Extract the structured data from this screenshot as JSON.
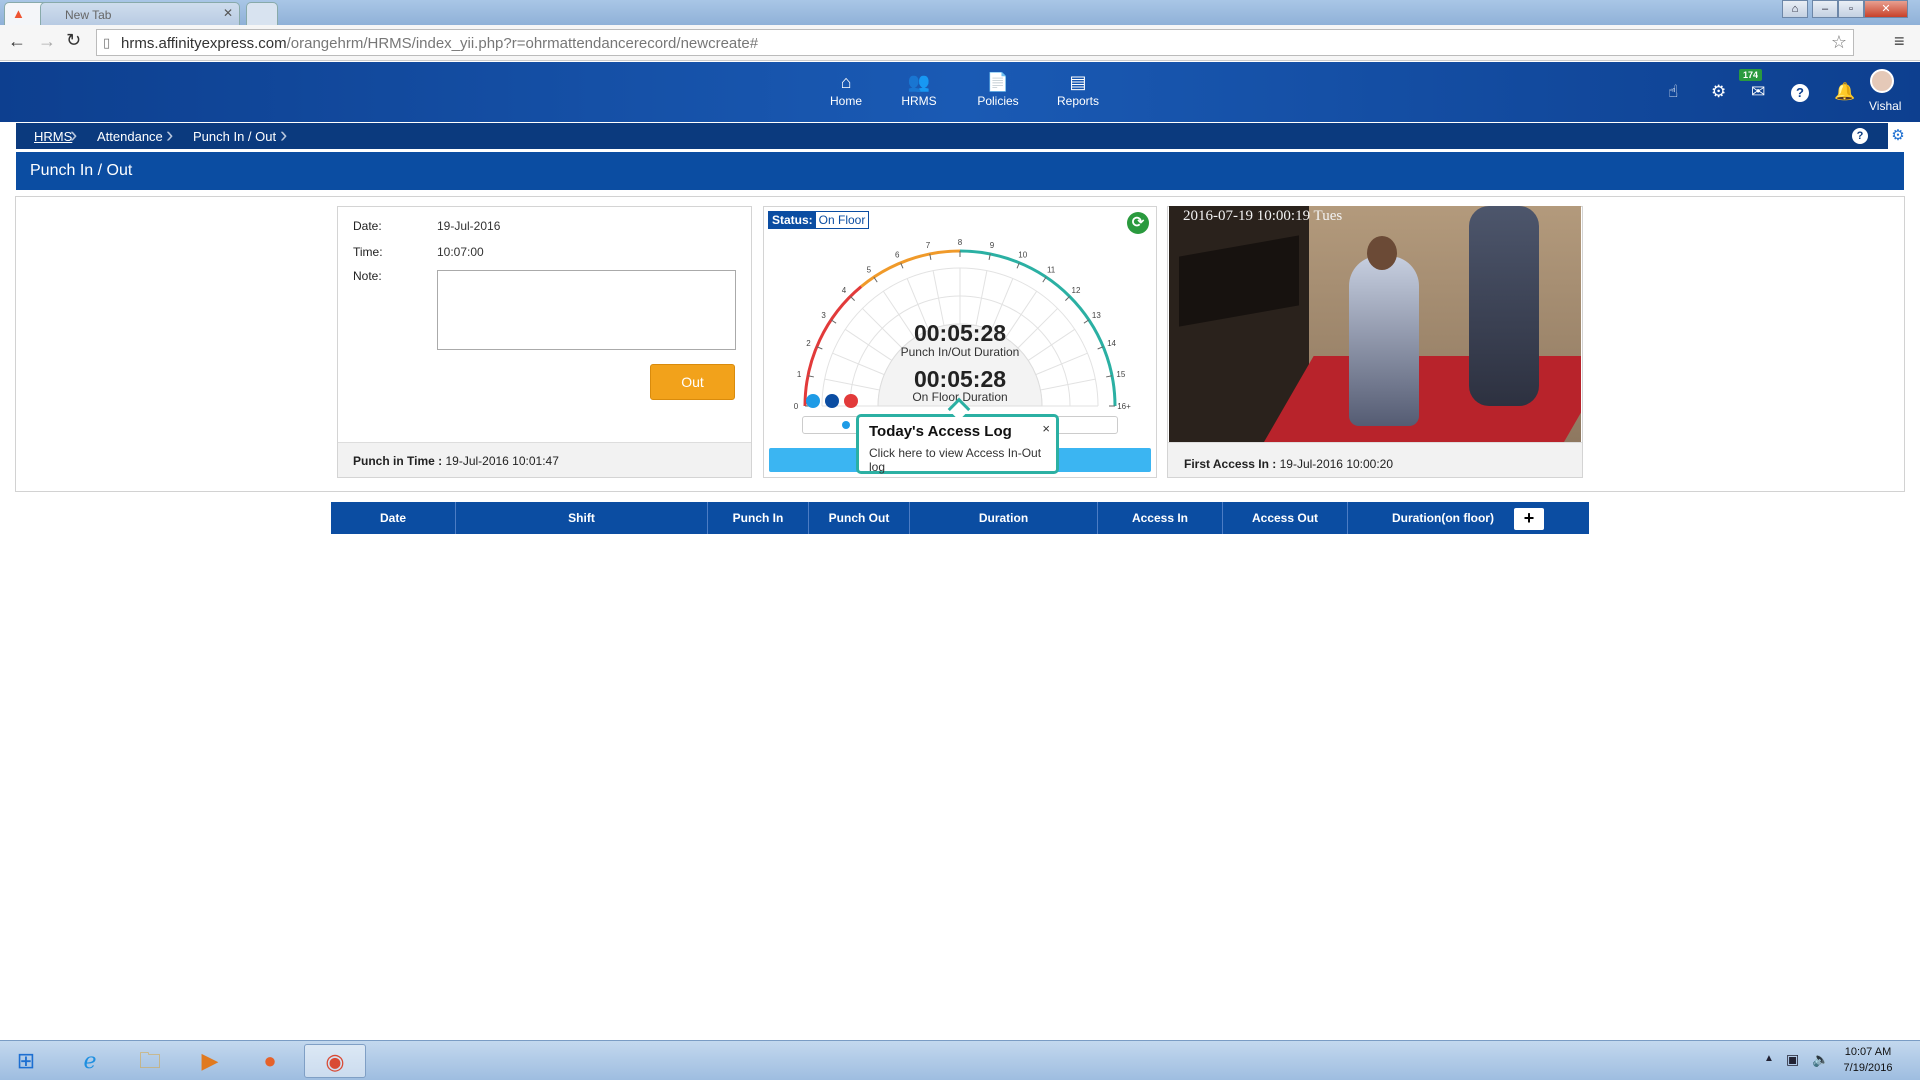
{
  "browser": {
    "tabs": [
      {
        "label": "",
        "active": true
      },
      {
        "label": "New Tab",
        "active": false
      }
    ],
    "url_host": "hrms.affinityexpress.com",
    "url_path": "/orangehrm/HRMS/index_yii.php?r=ohrmattendancerecord/newcreate#"
  },
  "nav": {
    "items": [
      {
        "label": "Home",
        "icon": "home-icon"
      },
      {
        "label": "HRMS",
        "icon": "people-icon"
      },
      {
        "label": "Policies",
        "icon": "policies-icon"
      },
      {
        "label": "Reports",
        "icon": "reports-icon"
      }
    ],
    "mail_badge": "174",
    "user_name": "Vishal"
  },
  "breadcrumb": [
    "HRMS",
    "Attendance",
    "Punch In / Out"
  ],
  "page_title": "Punch In / Out",
  "punch_form": {
    "date_label": "Date:",
    "date_value": "19-Jul-2016",
    "time_label": "Time:",
    "time_value": "10:07:00",
    "note_label": "Note:",
    "note_value": "",
    "out_button": "Out",
    "punch_in_label": "Punch in Time :",
    "punch_in_value": "19-Jul-2016 10:01:47"
  },
  "gauge": {
    "status_label": "Status:",
    "status_value": "On Floor",
    "punch_duration": "00:05:28",
    "punch_duration_label": "Punch In/Out Duration",
    "floor_duration": "00:05:28",
    "floor_duration_label": "On Floor Duration",
    "scale_ticks": [
      "0",
      "1",
      "2",
      "3",
      "4",
      "5",
      "6",
      "7",
      "8",
      "9",
      "10",
      "11",
      "12",
      "13",
      "14",
      "15",
      "16+"
    ],
    "colors": {
      "early": "#e23a3a",
      "mid": "#f09a2a",
      "late": "#2bb0a3",
      "punch": "#1e9be6",
      "floor": "#0b4da2"
    }
  },
  "access_popup": {
    "title": "Today's Access Log",
    "subtitle": "Click here to view Access In-Out log",
    "close": "×"
  },
  "camera": {
    "timestamp": "2016-07-19 10:00:19 Tues",
    "first_access_label": "First Access In :",
    "first_access_value": "19-Jul-2016 10:00:20"
  },
  "table": {
    "columns": [
      "Date",
      "Shift",
      "Punch In",
      "Punch Out",
      "Duration",
      "Access In",
      "Access Out",
      "Duration(on floor)"
    ],
    "add_button": "+"
  },
  "taskbar": {
    "time": "10:07 AM",
    "date": "7/19/2016"
  }
}
